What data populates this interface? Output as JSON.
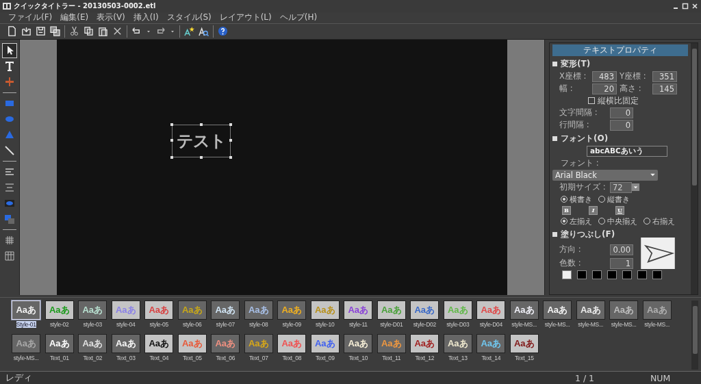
{
  "window": {
    "title": "クイックタイトラー - 20130503-0002.etl"
  },
  "menu": [
    "ファイル(F)",
    "編集(E)",
    "表示(V)",
    "挿入(I)",
    "スタイル(S)",
    "レイアウト(L)",
    "ヘルプ(H)"
  ],
  "toolbar": [
    {
      "kind": "new"
    },
    {
      "kind": "open"
    },
    {
      "kind": "save"
    },
    {
      "kind": "saveall"
    },
    {
      "kind": "sep"
    },
    {
      "kind": "cut"
    },
    {
      "kind": "copy"
    },
    {
      "kind": "paste"
    },
    {
      "kind": "delete"
    },
    {
      "kind": "sep"
    },
    {
      "kind": "undo"
    },
    {
      "kind": "drop"
    },
    {
      "kind": "redo"
    },
    {
      "kind": "drop"
    },
    {
      "kind": "sep"
    },
    {
      "kind": "style"
    },
    {
      "kind": "font"
    },
    {
      "kind": "sep"
    },
    {
      "kind": "help"
    }
  ],
  "tools": [
    {
      "kind": "select",
      "selected": true
    },
    {
      "kind": "text",
      "selected": false
    },
    {
      "kind": "cross",
      "selected": false
    },
    {
      "kind": "sep"
    },
    {
      "kind": "rect",
      "selected": false
    },
    {
      "kind": "ellipse",
      "selected": false
    },
    {
      "kind": "triangle",
      "selected": false
    },
    {
      "kind": "line",
      "selected": false
    },
    {
      "kind": "sep"
    },
    {
      "kind": "align",
      "selected": false
    },
    {
      "kind": "distribute",
      "selected": false
    },
    {
      "kind": "group",
      "selected": false
    },
    {
      "kind": "layer",
      "selected": false
    },
    {
      "kind": "sep"
    },
    {
      "kind": "grid",
      "selected": false
    },
    {
      "kind": "table",
      "selected": false
    }
  ],
  "canvas": {
    "text": "テスト"
  },
  "properties": {
    "title": "テキストプロパティ",
    "transform": {
      "heading": "変形(T)",
      "fields": [
        {
          "label": "X座標 :",
          "value": "483"
        },
        {
          "label": "Y座標 :",
          "value": "351"
        },
        {
          "label": "幅 :",
          "value": "20"
        },
        {
          "label": "高さ :",
          "value": "145"
        }
      ],
      "lock": {
        "label": "縦横比固定",
        "checked": false
      },
      "spacing": [
        {
          "label": "文字間隔 :",
          "value": "0"
        },
        {
          "label": "行間隔 :",
          "value": "0"
        }
      ]
    },
    "font": {
      "heading": "フォント(O)",
      "preview": "abcABCあいう",
      "font_label": "フォント :",
      "font_value": "Arial Black",
      "size_label": "初期サイズ :",
      "size_value": "72",
      "orientation": [
        {
          "label": "横書き",
          "selected": true
        },
        {
          "label": "縦書き",
          "selected": false
        }
      ],
      "styles": [
        "B",
        "I",
        "U"
      ],
      "align": [
        {
          "label": "左揃え",
          "selected": true
        },
        {
          "label": "中央揃え",
          "selected": false
        },
        {
          "label": "右揃え",
          "selected": false
        }
      ]
    },
    "fill": {
      "heading": "塗りつぶし(F)",
      "fields": [
        {
          "label": "方向 :",
          "value": "0.00"
        },
        {
          "label": "色数 :",
          "value": "1"
        }
      ],
      "swatches": [
        {
          "color": "#f0f0f0"
        },
        {
          "color": "#000000"
        },
        {
          "color": "#000000"
        },
        {
          "color": "#000000"
        },
        {
          "color": "#000000"
        },
        {
          "color": "#000000"
        },
        {
          "color": "#000000"
        }
      ]
    }
  },
  "styles": [
    {
      "label": "Style-01",
      "preview": "Aaあ",
      "selected": true
    },
    {
      "label": "style-02",
      "preview": "Aaあ",
      "selected": false
    },
    {
      "label": "style-03",
      "preview": "Aaあ",
      "selected": false
    },
    {
      "label": "style-04",
      "preview": "Aaあ",
      "selected": false
    },
    {
      "label": "style-05",
      "preview": "Aaあ",
      "selected": false
    },
    {
      "label": "style-06",
      "preview": "Aaあ",
      "selected": false
    },
    {
      "label": "style-07",
      "preview": "Aaあ",
      "selected": false
    },
    {
      "label": "style-08",
      "preview": "Aaあ",
      "selected": false
    },
    {
      "label": "style-09",
      "preview": "Aaあ",
      "selected": false
    },
    {
      "label": "style-10",
      "preview": "Aaあ",
      "selected": false
    },
    {
      "label": "style-11",
      "preview": "Aaあ",
      "selected": false
    },
    {
      "label": "style-D01",
      "preview": "Aaあ",
      "selected": false
    },
    {
      "label": "style-D02",
      "preview": "Aaあ",
      "selected": false
    },
    {
      "label": "style-D03",
      "preview": "Aaあ",
      "selected": false
    },
    {
      "label": "style-D04",
      "preview": "Aaあ",
      "selected": false
    },
    {
      "label": "style-MS...",
      "preview": "Aaあ",
      "selected": false
    },
    {
      "label": "style-MS...",
      "preview": "Aaあ",
      "selected": false
    },
    {
      "label": "style-MS...",
      "preview": "Aaあ",
      "selected": false
    },
    {
      "label": "style-MS...",
      "preview": "Aaあ",
      "selected": false
    },
    {
      "label": "style-MS...",
      "preview": "Aaあ",
      "selected": false
    },
    {
      "label": "style-MS...",
      "preview": "Aaあ",
      "selected": false
    },
    {
      "label": "Text_01",
      "preview": "Aaあ",
      "selected": false
    },
    {
      "label": "Text_02",
      "preview": "Aaあ",
      "selected": false
    },
    {
      "label": "Text_03",
      "preview": "Aaあ",
      "selected": false
    },
    {
      "label": "Text_04",
      "preview": "Aaあ",
      "selected": false
    },
    {
      "label": "Text_05",
      "preview": "Aaあ",
      "selected": false
    },
    {
      "label": "Text_06",
      "preview": "Aaあ",
      "selected": false
    },
    {
      "label": "Text_07",
      "preview": "Aaあ",
      "selected": false
    },
    {
      "label": "Text_08",
      "preview": "Aaあ",
      "selected": false
    },
    {
      "label": "Text_09",
      "preview": "Aaあ",
      "selected": false
    },
    {
      "label": "Text_10",
      "preview": "Aaあ",
      "selected": false
    },
    {
      "label": "Text_11",
      "preview": "Aaあ",
      "selected": false
    },
    {
      "label": "Text_12",
      "preview": "Aaあ",
      "selected": false
    },
    {
      "label": "Text_13",
      "preview": "Aaあ",
      "selected": false
    },
    {
      "label": "Text_14",
      "preview": "Aaあ",
      "selected": false
    },
    {
      "label": "Text_15",
      "preview": "Aaあ",
      "selected": false
    }
  ],
  "status_bar": {
    "status": "レディ",
    "page": "1 / 1",
    "keys": "NUM"
  }
}
